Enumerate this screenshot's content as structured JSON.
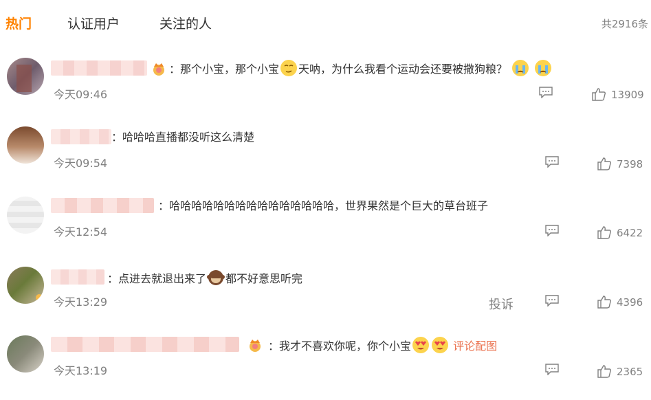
{
  "header": {
    "tabs": [
      {
        "label": "热门"
      },
      {
        "label": "认证用户"
      },
      {
        "label": "关注的人"
      }
    ],
    "total": "共2916条"
  },
  "comments": [
    {
      "text_a": "：那个小宝，那个小宝",
      "text_b": "天呐，为什么我看个运动会还要被撒狗粮？",
      "time": "今天09:46",
      "likes": "13909"
    },
    {
      "text": "：哈哈哈直播都没听这么清楚",
      "time": "今天09:54",
      "likes": "7398"
    },
    {
      "text": "：哈哈哈哈哈哈哈哈哈哈哈哈哈哈哈，世界果然是个巨大的草台班子",
      "time": "今天12:54",
      "likes": "6422"
    },
    {
      "text_a": "：点进去就退出来了",
      "text_b": "都不好意思听完",
      "time": "今天13:29",
      "report": "投诉",
      "likes": "4396"
    },
    {
      "text_a": "：我才不喜欢你呢，你个小宝",
      "link": "评论配图",
      "time": "今天13:19",
      "likes": "2365"
    }
  ],
  "icons": {
    "reply": "comment-bubble-icon",
    "like": "thumbs-up-icon",
    "emoji_1a": "smirk-emoji",
    "emoji_1b": "crying-emoji",
    "emoji_4": "see-no-evil-monkey-emoji",
    "emoji_5": "heart-eyes-emoji"
  },
  "colors": {
    "accent": "#ff8200",
    "muted": "#808080",
    "link": "#eb7350"
  }
}
